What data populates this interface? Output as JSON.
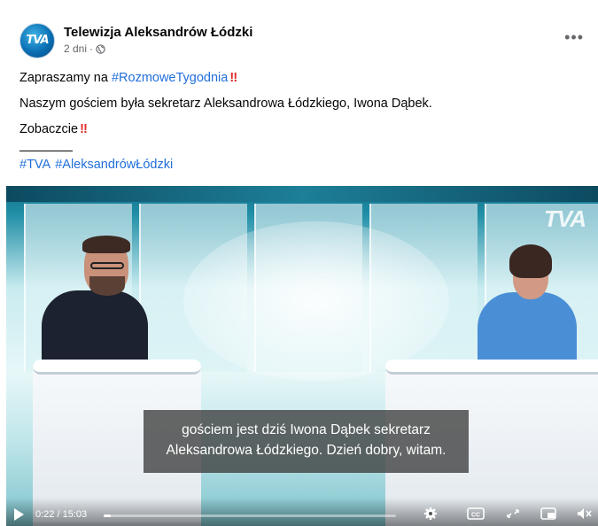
{
  "post": {
    "page_name": "Telewizja Aleksandrów Łódzki",
    "avatar_text": "TVA",
    "time_ago": "2 dni",
    "separator": "·",
    "privacy_icon": "globe-icon",
    "more_icon": "more-horizontal-icon",
    "more_label": "•••",
    "lines": [
      {
        "before": "Zapraszamy na ",
        "hashtag": "#RozmoweTygodnia",
        "emphasis": "‼"
      },
      {
        "text": "Naszym gościem była sekretarz Aleksandrowa Łódzkiego, Iwona Dąbek."
      },
      {
        "before": "Zobaczcie",
        "emphasis": "‼"
      }
    ],
    "hashtags": [
      "#TVA",
      "#AleksandrówŁódzki"
    ]
  },
  "video": {
    "watermark": "TVA",
    "caption_line1": "gościem jest dziś Iwona Dąbek sekretarz",
    "caption_line2": "Aleksandrowa Łódzkiego. Dzień dobry, witam.",
    "time_display": "0:22 / 15:03",
    "progress_fraction": 0.024,
    "icons": {
      "play": "play-icon",
      "settings": "gear-icon",
      "captions": "closed-captions-icon",
      "fullscreen": "expand-icon",
      "miniplayer": "picture-in-picture-icon",
      "volume": "volume-muted-icon"
    },
    "cc_label": "CC"
  },
  "colors": {
    "link": "#216fdb",
    "emphasis": "#e02a2a",
    "secondary_text": "#65676b"
  }
}
